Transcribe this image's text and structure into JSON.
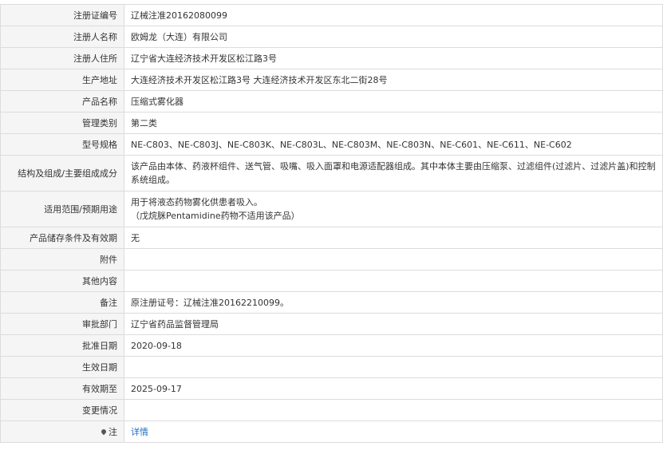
{
  "rows": [
    {
      "key": "注册证编号",
      "value": "辽械注准20162080099"
    },
    {
      "key": "注册人名称",
      "value": "欧姆龙（大连）有限公司"
    },
    {
      "key": "注册人住所",
      "value": "辽宁省大连经济技术开发区松江路3号"
    },
    {
      "key": "生产地址",
      "value": "大连经济技术开发区松江路3号 大连经济技术开发区东北二街28号"
    },
    {
      "key": "产品名称",
      "value": "压缩式雾化器"
    },
    {
      "key": "管理类别",
      "value": "第二类"
    },
    {
      "key": "型号规格",
      "value": "NE-C803、NE-C803J、NE-C803K、NE-C803L、NE-C803M、NE-C803N、NE-C601、NE-C611、NE-C602"
    },
    {
      "key": "结构及组成/主要组成成分",
      "value": "该产品由本体、药液杯组件、送气管、吸嘴、吸入面罩和电源适配器组成。其中本体主要由压缩泵、过滤组件(过滤片、过滤片盖)和控制系统组成。"
    },
    {
      "key": "适用范围/预期用途",
      "value_line1": "用于将液态药物雾化供患者吸入。",
      "value_line2": "（戊烷脒Pentamidine药物不适用该产品）"
    },
    {
      "key": "产品储存条件及有效期",
      "value": "无"
    },
    {
      "key": "附件",
      "value": ""
    },
    {
      "key": "其他内容",
      "value": ""
    },
    {
      "key": "备注",
      "value": "原注册证号：辽械注准20162210099。"
    },
    {
      "key": "审批部门",
      "value": "辽宁省药品监督管理局"
    },
    {
      "key": "批准日期",
      "value": "2020-09-18"
    },
    {
      "key": "生效日期",
      "value": ""
    },
    {
      "key": "有效期至",
      "value": "2025-09-17"
    },
    {
      "key": "变更情况",
      "value": ""
    },
    {
      "key": "注",
      "icon": "map-pin-icon",
      "link": "详情"
    }
  ]
}
